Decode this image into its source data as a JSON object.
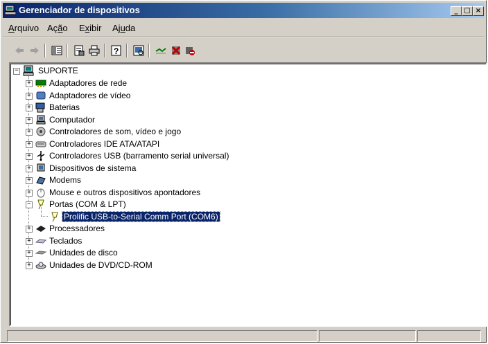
{
  "window": {
    "title": "Gerenciador de dispositivos"
  },
  "menu": [
    {
      "u": "A",
      "rest": "rquivo"
    },
    {
      "u": "",
      "pre": "Aç",
      "uu": "ã",
      "post": "o"
    },
    {
      "u": "",
      "pre": "E",
      "uu": "x",
      "post": "ibir"
    },
    {
      "u": "",
      "pre": "Aj",
      "uu": "u",
      "post": "da"
    }
  ],
  "menu_full": [
    "Arquivo",
    "Ação",
    "Exibir",
    "Ajuda"
  ],
  "toolbar": {
    "icons": [
      "back-icon",
      "forward-icon",
      "view-icon",
      "properties-icon",
      "print-icon",
      "help-icon",
      "scan-icon",
      "update-driver-icon",
      "uninstall-icon",
      "disable-icon"
    ]
  },
  "tree": {
    "root": "SUPORTE",
    "items": [
      {
        "label": "Adaptadores de rede",
        "icon": "network-adapter-icon"
      },
      {
        "label": "Adaptadores de vídeo",
        "icon": "display-adapter-icon"
      },
      {
        "label": "Baterias",
        "icon": "battery-icon"
      },
      {
        "label": "Computador",
        "icon": "computer-icon"
      },
      {
        "label": "Controladores de som, vídeo e jogo",
        "icon": "sound-icon"
      },
      {
        "label": "Controladores IDE ATA/ATAPI",
        "icon": "ide-controller-icon"
      },
      {
        "label": "Controladores USB (barramento serial universal)",
        "icon": "usb-icon"
      },
      {
        "label": "Dispositivos de sistema",
        "icon": "system-device-icon"
      },
      {
        "label": "Modems",
        "icon": "modem-icon"
      },
      {
        "label": "Mouse e outros dispositivos apontadores",
        "icon": "mouse-icon"
      },
      {
        "label": "Portas (COM & LPT)",
        "icon": "port-icon",
        "expanded": true
      },
      {
        "label": "Processadores",
        "icon": "processor-icon"
      },
      {
        "label": "Teclados",
        "icon": "keyboard-icon"
      },
      {
        "label": "Unidades de disco",
        "icon": "disk-drive-icon"
      },
      {
        "label": "Unidades de DVD/CD-ROM",
        "icon": "dvd-drive-icon"
      }
    ],
    "child_of_ports": "Prolific USB-to-Serial Comm Port (COM6)",
    "expand_plus": "+",
    "expand_minus": "−"
  },
  "colors": {
    "title_start": "#0a246a",
    "title_end": "#a6caf0",
    "selection": "#0a246a",
    "face": "#d4d0c8"
  }
}
